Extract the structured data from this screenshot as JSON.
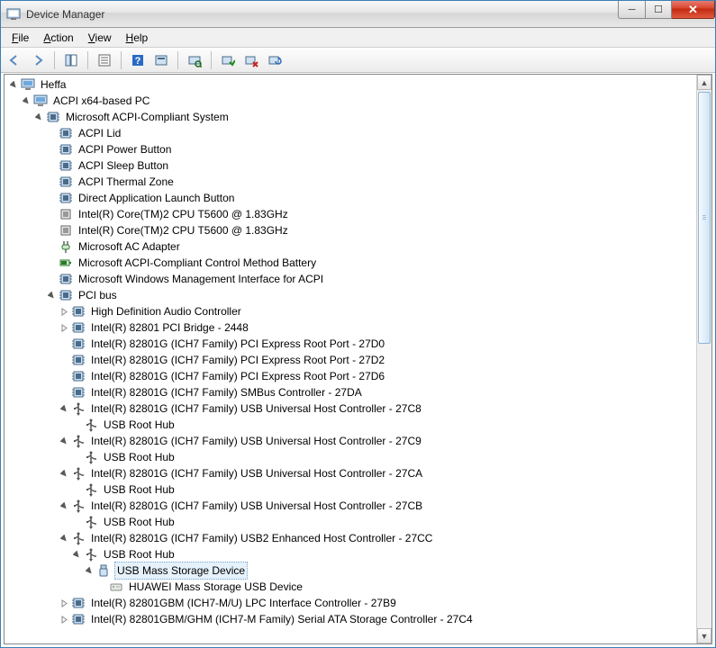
{
  "window": {
    "title": "Device Manager"
  },
  "menu": {
    "file": "File",
    "action": "Action",
    "view": "View",
    "help": "Help"
  },
  "win_controls": {
    "min": "─",
    "max": "☐",
    "close": "✕"
  },
  "scroll": {
    "up": "▲",
    "down": "▼"
  },
  "tree": {
    "root": "Heffa",
    "pc": "ACPI x64-based PC",
    "sys": "Microsoft ACPI-Compliant System",
    "items": {
      "lid": "ACPI Lid",
      "pwr": "ACPI Power Button",
      "slp": "ACPI Sleep Button",
      "thz": "ACPI Thermal Zone",
      "dalb": "Direct Application Launch Button",
      "cpu1": "Intel(R) Core(TM)2 CPU          T5600  @ 1.83GHz",
      "cpu2": "Intel(R) Core(TM)2 CPU          T5600  @ 1.83GHz",
      "acad": "Microsoft AC Adapter",
      "batt": "Microsoft ACPI-Compliant Control Method Battery",
      "wmi": "Microsoft Windows Management Interface for ACPI",
      "pci": "PCI bus",
      "hda": "High Definition Audio Controller",
      "pcibridge": "Intel(R) 82801 PCI Bridge - 2448",
      "exp0": "Intel(R) 82801G (ICH7 Family) PCI Express Root Port - 27D0",
      "exp2": "Intel(R) 82801G (ICH7 Family) PCI Express Root Port - 27D2",
      "exp6": "Intel(R) 82801G (ICH7 Family) PCI Express Root Port - 27D6",
      "smbus": "Intel(R) 82801G (ICH7 Family) SMBus Controller - 27DA",
      "usb_c8": "Intel(R) 82801G (ICH7 Family) USB Universal Host Controller - 27C8",
      "usb_c9": "Intel(R) 82801G (ICH7 Family) USB Universal Host Controller - 27C9",
      "usb_ca": "Intel(R) 82801G (ICH7 Family) USB Universal Host Controller - 27CA",
      "usb_cb": "Intel(R) 82801G (ICH7 Family) USB Universal Host Controller - 27CB",
      "usb2_cc": "Intel(R) 82801G (ICH7 Family) USB2 Enhanced Host Controller - 27CC",
      "roothub": "USB Root Hub",
      "massstorage": "USB Mass Storage Device",
      "huawei": "HUAWEI Mass Storage USB Device",
      "lpc": "Intel(R) 82801GBM (ICH7-M/U) LPC Interface Controller - 27B9",
      "sata": "Intel(R) 82801GBM/GHM (ICH7-M Family) Serial ATA Storage Controller - 27C4"
    }
  }
}
